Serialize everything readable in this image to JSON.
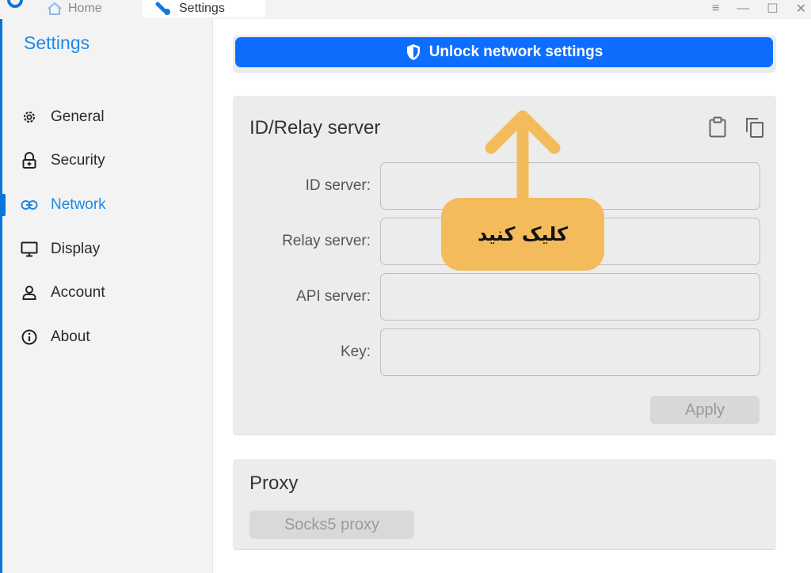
{
  "titlebar": {
    "tabs": [
      {
        "label": "Home",
        "icon": "home-icon"
      },
      {
        "label": "Settings",
        "icon": "wrench-icon"
      }
    ],
    "controls": [
      "menu-icon",
      "minimize-icon",
      "maximize-icon",
      "close-icon"
    ]
  },
  "sidebar": {
    "title": "Settings",
    "active": "Network",
    "items": [
      {
        "label": "General",
        "icon": "gear-icon"
      },
      {
        "label": "Security",
        "icon": "lock-icon"
      },
      {
        "label": "Network",
        "icon": "link-icon"
      },
      {
        "label": "Display",
        "icon": "monitor-icon"
      },
      {
        "label": "Account",
        "icon": "person-icon"
      },
      {
        "label": "About",
        "icon": "info-icon"
      }
    ]
  },
  "main": {
    "unlock_label": "Unlock network settings",
    "relay": {
      "title": "ID/Relay server",
      "fields": [
        {
          "label": "ID server:",
          "value": ""
        },
        {
          "label": "Relay server:",
          "value": ""
        },
        {
          "label": "API server:",
          "value": ""
        },
        {
          "label": "Key:",
          "value": ""
        }
      ],
      "apply_label": "Apply"
    },
    "proxy": {
      "title": "Proxy",
      "socks_label": "Socks5 proxy"
    }
  },
  "annotation": {
    "callout_text": "کلیک کنید"
  },
  "colors": {
    "accent": "#1e88e5",
    "primary_button": "#0d6efd",
    "callout": "#f4bb5d",
    "sidebar_bg": "#f3f3f3",
    "card_bg": "#ececec"
  }
}
